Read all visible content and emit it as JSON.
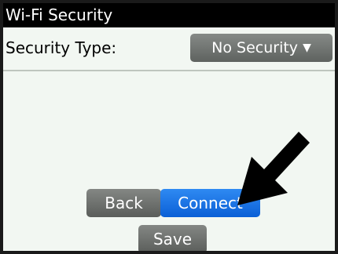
{
  "window": {
    "title": "Wi-Fi Security"
  },
  "form": {
    "security_type_label": "Security Type:",
    "security_type_value": "No Security"
  },
  "actions": {
    "back_label": "Back",
    "connect_label": "Connect",
    "save_label": "Save"
  },
  "icons": {
    "dropdown": "caret-down-icon",
    "pointer": "arrow-pointer-icon"
  },
  "colors": {
    "accent": "#0a5fd6",
    "button_gray": "#5e625f",
    "background": "#f2f7f2",
    "title_bar": "#000000"
  }
}
